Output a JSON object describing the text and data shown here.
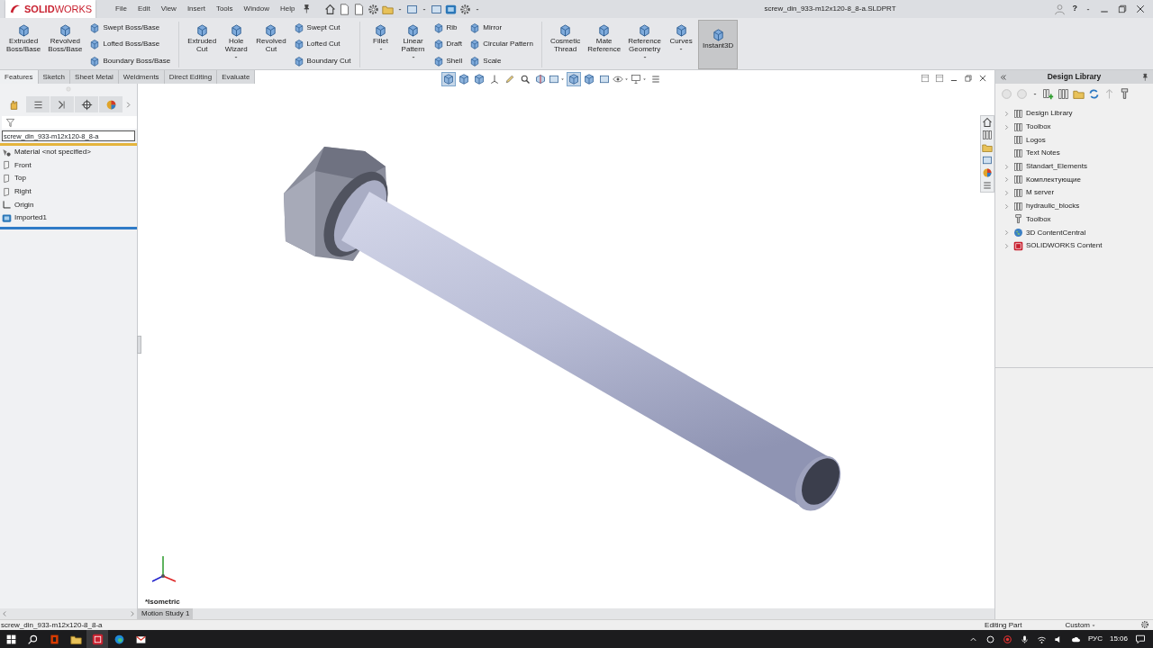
{
  "app": {
    "logo": "**SOLID**WORKS"
  },
  "menu": [
    {
      "label": "File"
    },
    {
      "label": "Edit"
    },
    {
      "label": "View"
    },
    {
      "label": "Insert"
    },
    {
      "label": "Tools"
    },
    {
      "label": "Window"
    },
    {
      "label": "Help"
    }
  ],
  "document_title": "screw_din_933-m12x120-8_8-a.SLDPRT",
  "help_label": "?",
  "ribbon": [
    {
      "kind": "large",
      "label": "Extruded Boss/Base",
      "dropdown": false,
      "on": false
    },
    {
      "kind": "large",
      "label": "Revolved Boss/Base",
      "dropdown": false,
      "on": false
    },
    {
      "kind": "stack",
      "items": [
        "Swept Boss/Base",
        "Lofted Boss/Base",
        "Boundary Boss/Base"
      ]
    },
    {
      "kind": "separator"
    },
    {
      "kind": "large",
      "label": "Extruded Cut",
      "dropdown": false,
      "on": false
    },
    {
      "kind": "large",
      "label": "Hole Wizard",
      "dropdown": true,
      "on": false
    },
    {
      "kind": "large",
      "label": "Revolved Cut",
      "dropdown": false,
      "on": false
    },
    {
      "kind": "stack",
      "items": [
        "Swept Cut",
        "Lofted Cut",
        "Boundary Cut"
      ]
    },
    {
      "kind": "separator"
    },
    {
      "kind": "large",
      "label": "Fillet",
      "dropdown": true,
      "on": false
    },
    {
      "kind": "large",
      "label": "Linear Pattern",
      "dropdown": true,
      "on": false
    },
    {
      "kind": "stack",
      "items": [
        "Rib",
        "Draft",
        "Shell"
      ]
    },
    {
      "kind": "stack",
      "items": [
        "Mirror",
        "Circular Pattern",
        "Scale"
      ]
    },
    {
      "kind": "separator"
    },
    {
      "kind": "large",
      "label": "Cosmetic Thread",
      "dropdown": false,
      "on": false
    },
    {
      "kind": "large",
      "label": "Mate Reference",
      "dropdown": false,
      "on": false
    },
    {
      "kind": "large",
      "label": "Reference Geometry",
      "dropdown": true,
      "on": false
    },
    {
      "kind": "large",
      "label": "Curves",
      "dropdown": true,
      "on": false
    },
    {
      "kind": "large",
      "label": "Instant3D",
      "dropdown": false,
      "on": true
    }
  ],
  "command_tabs": [
    {
      "label": "Features",
      "selected": true
    },
    {
      "label": "Sketch",
      "selected": false
    },
    {
      "label": "Sheet Metal",
      "selected": false
    },
    {
      "label": "Weldments",
      "selected": false
    },
    {
      "label": "Direct Editing",
      "selected": false
    },
    {
      "label": "Evaluate",
      "selected": false
    }
  ],
  "feature_manager": {
    "tabs": [
      {
        "kind": "features",
        "selected": true
      },
      {
        "kind": "properties",
        "selected": false
      },
      {
        "kind": "configurations",
        "selected": false
      },
      {
        "kind": "dimxpert",
        "selected": false
      },
      {
        "kind": "display",
        "selected": false
      }
    ],
    "tree": {
      "name": "screw_din_933-m12x120-8_8-a",
      "items": [
        {
          "label": "Material <not specified>",
          "kind": "material"
        },
        {
          "label": "Front",
          "kind": "plane"
        },
        {
          "label": "Top",
          "kind": "plane"
        },
        {
          "label": "Right",
          "kind": "plane"
        },
        {
          "label": "Origin",
          "kind": "origin"
        },
        {
          "label": "Imported1",
          "kind": "body"
        }
      ]
    }
  },
  "viewport": {
    "view_toolbar": [
      {
        "kind": "cube",
        "on": true,
        "dropdown": false
      },
      {
        "kind": "cube",
        "on": false,
        "dropdown": false
      },
      {
        "kind": "cube",
        "on": false,
        "dropdown": false
      },
      {
        "kind": "axes",
        "on": false,
        "dropdown": false
      },
      {
        "kind": "pencil",
        "on": false,
        "dropdown": false
      },
      {
        "kind": "magnifier",
        "on": false,
        "dropdown": false
      },
      {
        "kind": "section",
        "on": false,
        "dropdown": false
      },
      {
        "kind": "display",
        "on": false,
        "dropdown": true
      },
      {
        "kind": "cube",
        "on": true,
        "dropdown": false
      },
      {
        "kind": "cube",
        "on": false,
        "dropdown": false
      },
      {
        "kind": "display",
        "on": false,
        "dropdown": false
      },
      {
        "kind": "eye",
        "on": false,
        "dropdown": true
      },
      {
        "kind": "monitor",
        "on": false,
        "dropdown": true
      },
      {
        "kind": "list",
        "on": false,
        "dropdown": false
      }
    ],
    "view_label": "*Isometric",
    "motion_tab": "Motion Study 1"
  },
  "design_library": {
    "title": "Design Library",
    "items": [
      {
        "label": "Design Library",
        "kind": "library",
        "expandable": true
      },
      {
        "label": "Toolbox",
        "kind": "library",
        "expandable": true
      },
      {
        "label": "Logos",
        "kind": "library",
        "expandable": false
      },
      {
        "label": "Text Notes",
        "kind": "library",
        "expandable": false
      },
      {
        "label": "Standart_Elements",
        "kind": "library",
        "expandable": true
      },
      {
        "label": "Комплектующие",
        "kind": "library",
        "expandable": true
      },
      {
        "label": "M server",
        "kind": "library",
        "expandable": true
      },
      {
        "label": "hydraulic_blocks",
        "kind": "library",
        "expandable": true
      },
      {
        "label": "Toolbox",
        "kind": "toolbox",
        "expandable": false
      },
      {
        "label": "3D ContentCentral",
        "kind": "globe",
        "expandable": true
      },
      {
        "label": "SOLIDWORKS Content",
        "kind": "content",
        "expandable": true
      }
    ]
  },
  "status_bar": {
    "document": "screw_din_933-m12x120-8_8-a",
    "mode": "Editing Part",
    "units": "Custom"
  },
  "taskbar": {
    "language": "РУС",
    "time": "15:06"
  }
}
